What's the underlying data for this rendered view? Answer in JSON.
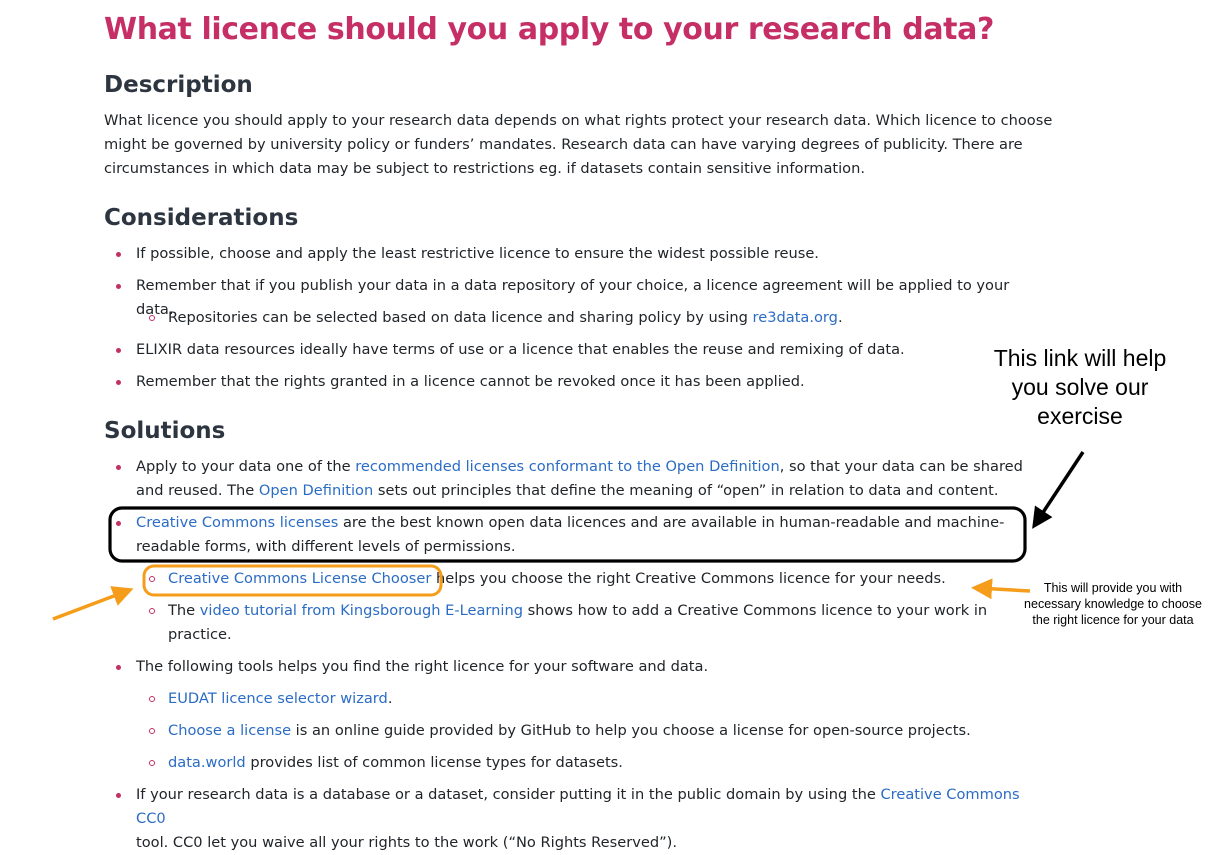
{
  "title": "What licence should you apply to your research data?",
  "description": {
    "heading": "Description",
    "line1": "What licence you should apply to your research data depends on what rights protect your research data. Which licence to choose",
    "line2": "might be governed by university policy or funders’ mandates. Research data can have varying degrees of publicity. There are",
    "line3": "circumstances in which data may be subject to restrictions eg. if datasets contain sensitive information."
  },
  "considerations": {
    "heading": "Considerations",
    "item1": "If possible, choose and apply the least restrictive licence to ensure the widest possible reuse.",
    "item2": "Remember that if you publish your data in a data repository of your choice, a licence agreement will be applied to your data.",
    "item2_sub1": {
      "text_before": "Repositories can be selected based on data licence and sharing policy by using ",
      "link": "re3data.org",
      "text_after": "."
    },
    "item3": "ELIXIR data resources ideally have terms of use or a licence that enables the reuse and remixing of data.",
    "item4": "Remember that the rights granted in a licence cannot be revoked once it has been applied."
  },
  "solutions": {
    "heading": "Solutions",
    "item1": {
      "text_before": "Apply to your data one of the ",
      "link1": "recommended licenses conformant to the Open Definition",
      "text_middle": ", so that your data can be shared",
      "text_line2a": "and reused. The ",
      "link2": "Open Definition",
      "text_after": " sets out principles that define the meaning of “open” in relation to data and content."
    },
    "item2": {
      "link": "Creative Commons licenses",
      "text_line1": " are the best known open data licences and are available in human-readable and machine-",
      "text_line2": "readable forms, with different levels of permissions."
    },
    "item2_sub1": {
      "link": "Creative Commons License Chooser",
      "text_after": " helps you choose the right Creative Commons licence for your needs."
    },
    "item2_sub2": {
      "text_before": "The ",
      "link": "video tutorial from Kingsborough E-Learning",
      "text_after": " shows how to add a Creative Commons licence to your work in",
      "text_line2": "practice."
    },
    "item3": "The following tools helps you find the right licence for your software and data.",
    "item3_sub1": {
      "link": "EUDAT licence selector wizard",
      "text_after": "."
    },
    "item3_sub2": {
      "link": "Choose a license",
      "text_after": " is an online guide provided by GitHub to help you choose a license for open-source projects."
    },
    "item3_sub3": {
      "link": "data.world",
      "text_after": " provides list of common license types for datasets."
    },
    "item4": {
      "text_before": "If your research data is a database or a dataset, consider putting it in the public domain by using the ",
      "link": "Creative Commons CC0",
      "text_line2": "tool. CC0 let you waive all your rights to the work (“No Rights Reserved”)."
    }
  },
  "annotations": {
    "black_note": {
      "line1": "This link will help",
      "line2": "you solve our",
      "line3": "exercise"
    },
    "orange_note": {
      "line1": "This will provide you with",
      "line2": "necessary knowledge to choose",
      "line3": "the right licence for your data"
    }
  },
  "colors": {
    "title": "#c52f65",
    "heading": "#2d3640",
    "link": "#2b6cc4",
    "bullet": "#c52f65",
    "annotation_orange": "#f59d1b",
    "annotation_black": "#000000"
  }
}
